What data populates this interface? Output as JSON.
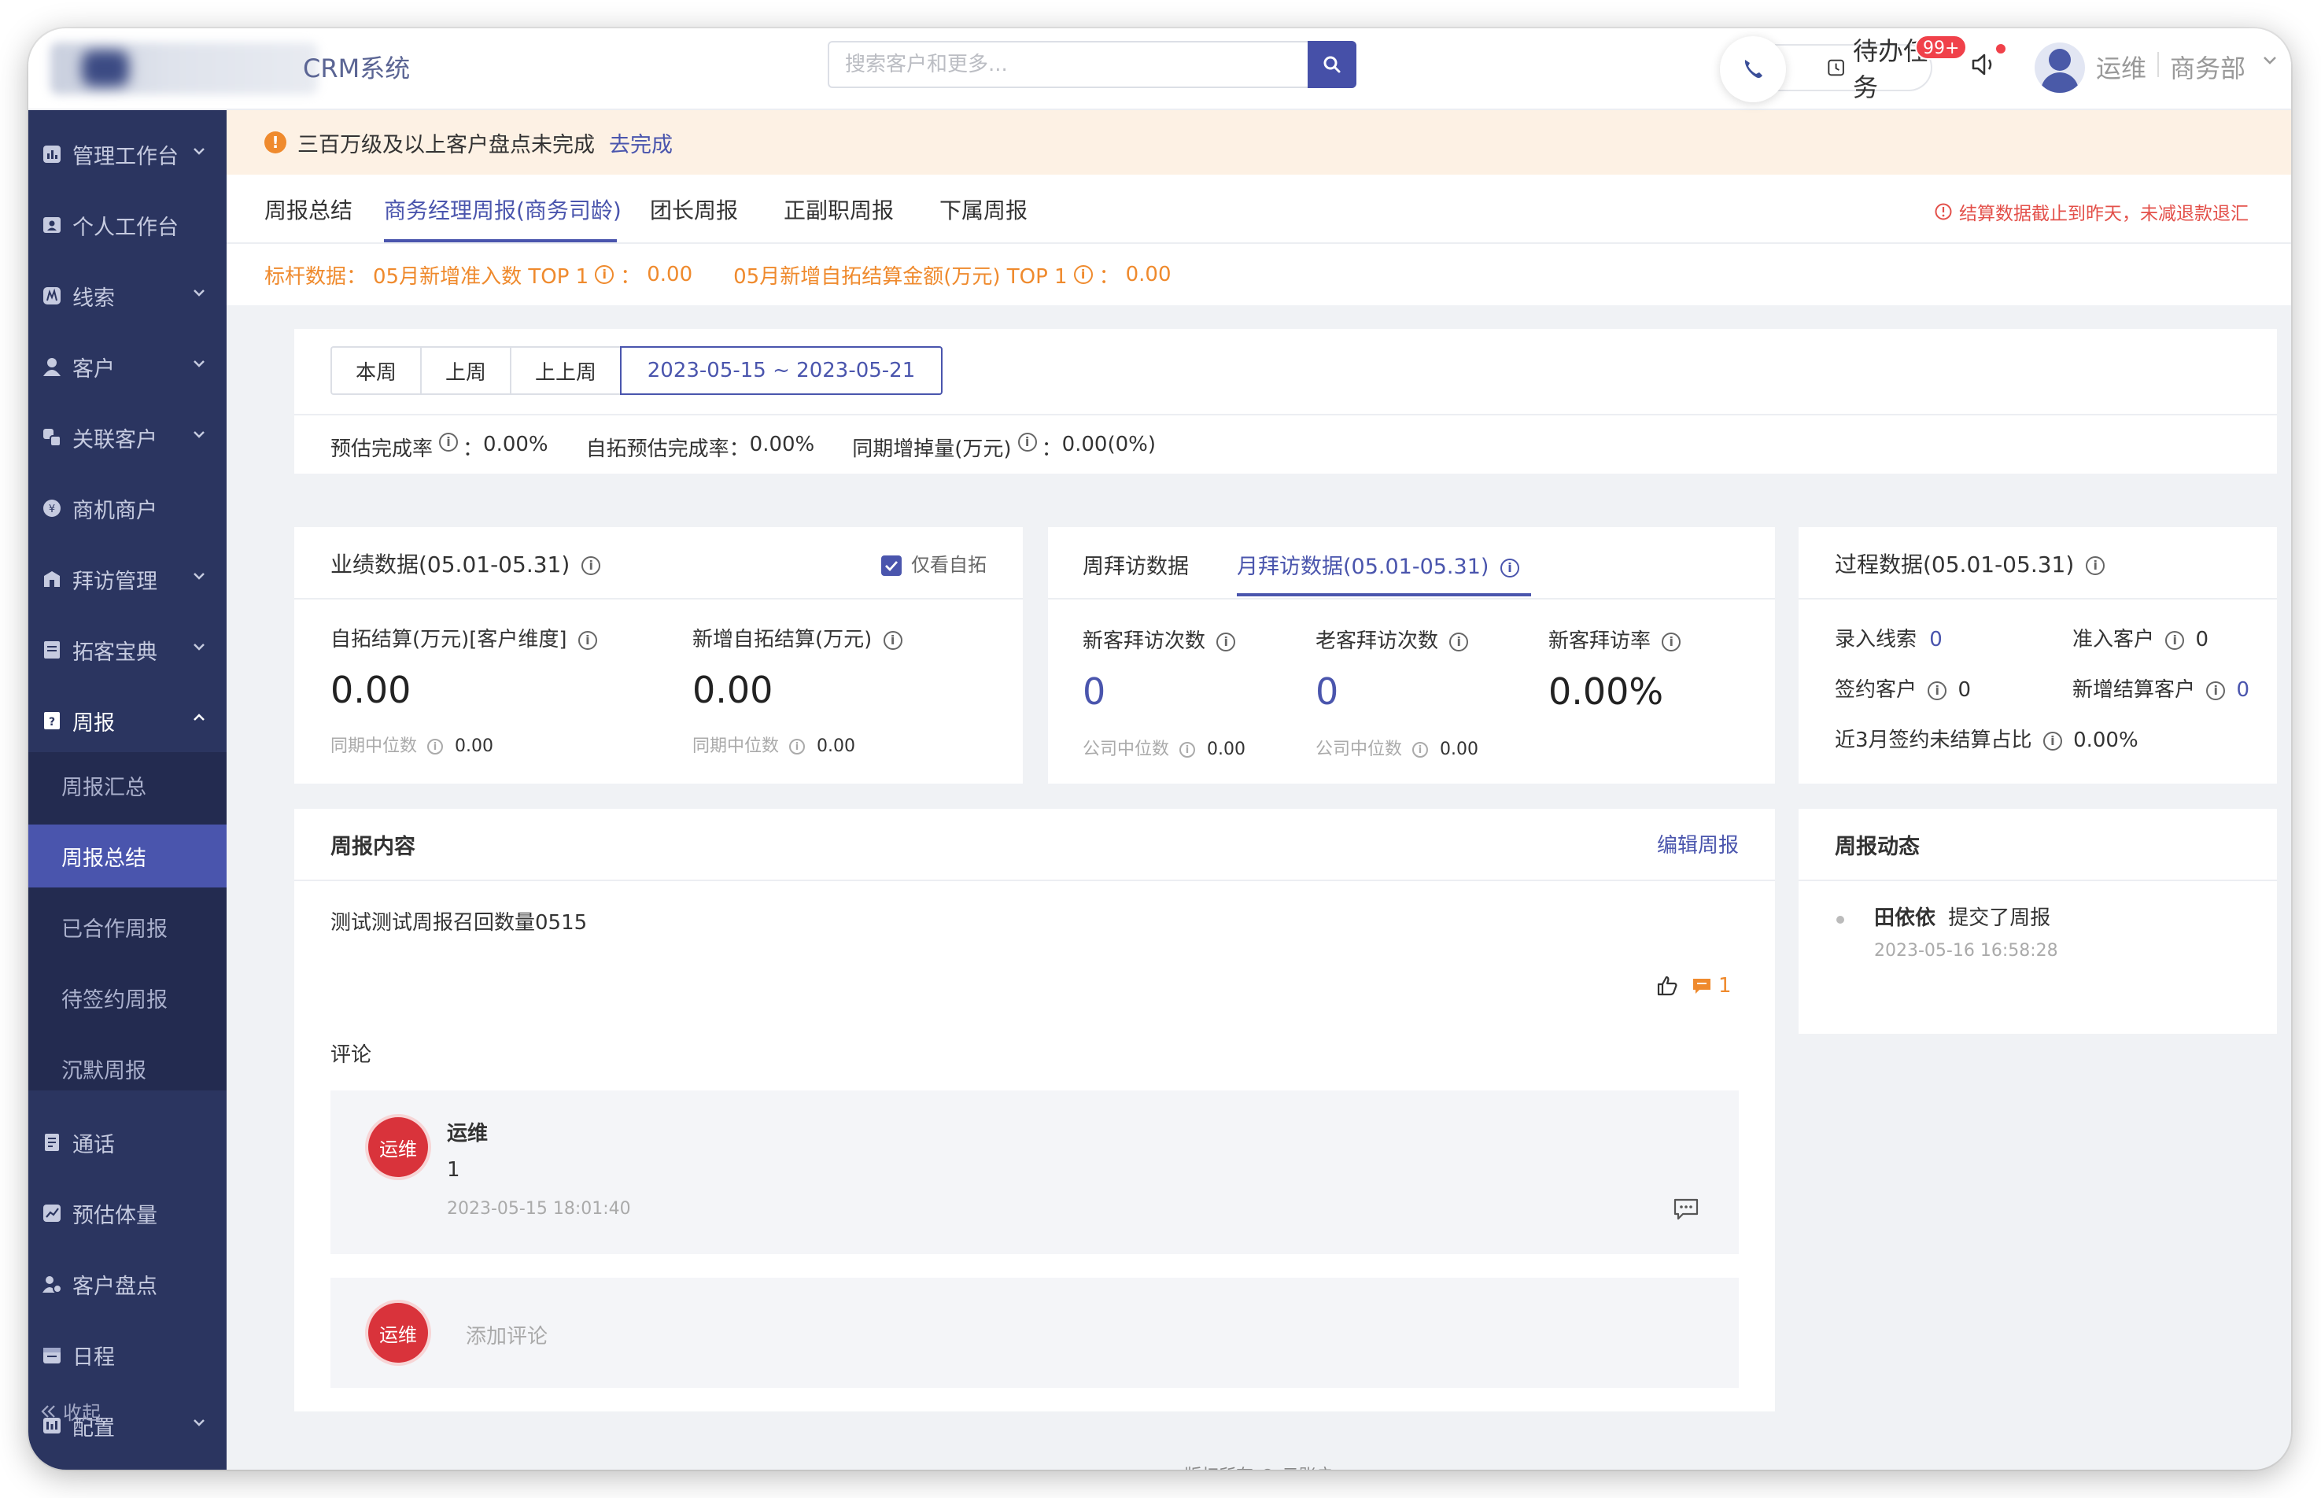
{
  "header": {
    "app_title": "CRM系统",
    "search_placeholder": "搜索客户和更多...",
    "todo_label": "待办任务",
    "todo_badge": "99+",
    "user_name": "运维",
    "user_dept": "商务部"
  },
  "sidebar": {
    "items": [
      {
        "label": "管理工作台",
        "icon": "dashboard-icon",
        "caret": true
      },
      {
        "label": "个人工作台",
        "icon": "user-card-icon",
        "caret": false
      },
      {
        "label": "线索",
        "icon": "clue-icon",
        "caret": true
      },
      {
        "label": "客户",
        "icon": "person-icon",
        "caret": true
      },
      {
        "label": "关联客户",
        "icon": "link-customer-icon",
        "caret": true
      },
      {
        "label": "商机商户",
        "icon": "coin-icon",
        "caret": false
      },
      {
        "label": "拜访管理",
        "icon": "visit-icon",
        "caret": true
      },
      {
        "label": "拓客宝典",
        "icon": "book-icon",
        "caret": true
      },
      {
        "label": "周报",
        "icon": "report-icon",
        "caret": "up"
      }
    ],
    "sub_items": [
      "周报汇总",
      "周报总结",
      "已合作周报",
      "待签约周报",
      "沉默周报"
    ],
    "active_sub": "周报总结",
    "bottom_items": [
      {
        "label": "通话",
        "icon": "call-log-icon",
        "caret": false
      },
      {
        "label": "预估体量",
        "icon": "estimate-icon",
        "caret": false
      },
      {
        "label": "客户盘点",
        "icon": "inventory-icon",
        "caret": false
      },
      {
        "label": "日程",
        "icon": "calendar-icon",
        "caret": false
      },
      {
        "label": "配置",
        "icon": "config-icon",
        "caret": true
      }
    ],
    "collapse_label": "收起"
  },
  "notice": {
    "text": "三百万级及以上客户盘点未完成",
    "link": "去完成"
  },
  "tabs": {
    "items": [
      "周报总结",
      "商务经理周报(商务司龄)",
      "团长周报",
      "正副职周报",
      "下属周报"
    ],
    "active": "商务经理周报(商务司龄)",
    "note": "结算数据截止到昨天，未减退款退汇"
  },
  "benchmark": {
    "label": "标杆数据：",
    "item1_label": "05月新增准入数 TOP 1",
    "item1_value": "0.00",
    "item2_label": "05月新增自拓结算金额(万元) TOP 1",
    "item2_value": "0.00"
  },
  "period": {
    "buttons": [
      "本周",
      "上周",
      "上上周"
    ],
    "range": "2023-05-15 ~ 2023-05-21",
    "stats": [
      {
        "label": "预估完成率",
        "info": true,
        "value": "0.00%"
      },
      {
        "label": "自拓预估完成率：",
        "info": false,
        "value": "0.00%"
      },
      {
        "label": "同期增掉量(万元)",
        "info": true,
        "value": "0.00(0%)"
      }
    ]
  },
  "performance": {
    "title": "业绩数据(05.01-05.31)",
    "checkbox_label": "仅看自拓",
    "metrics": [
      {
        "label": "自拓结算(万元)[客户维度]",
        "value": "0.00",
        "median_label": "同期中位数",
        "median_value": "0.00"
      },
      {
        "label": "新增自拓结算(万元)",
        "value": "0.00",
        "median_label": "同期中位数",
        "median_value": "0.00"
      }
    ]
  },
  "visits": {
    "tabs": [
      "周拜访数据",
      "月拜访数据(05.01-05.31)"
    ],
    "active_tab": "月拜访数据(05.01-05.31)",
    "metrics": [
      {
        "label": "新客拜访次数",
        "value": "0",
        "median_label": "公司中位数",
        "median_value": "0.00"
      },
      {
        "label": "老客拜访次数",
        "value": "0",
        "median_label": "公司中位数",
        "median_value": "0.00"
      },
      {
        "label": "新客拜访率",
        "value": "0.00%"
      }
    ]
  },
  "process": {
    "title": "过程数据(05.01-05.31)",
    "items": [
      {
        "label": "录入线索",
        "value": "0"
      },
      {
        "label": "准入客户",
        "value": "0"
      },
      {
        "label": "签约客户",
        "value": "0"
      },
      {
        "label": "新增结算客户",
        "value": "0"
      },
      {
        "label": "近3月签约未结算占比",
        "value": "0.00%"
      }
    ]
  },
  "report": {
    "title": "周报内容",
    "edit_label": "编辑周报",
    "content": "测试测试周报召回数量0515",
    "comment_count": "1",
    "comments_title": "评论",
    "comment": {
      "avatar": "运维",
      "author": "运维",
      "text": "1",
      "time": "2023-05-15 18:01:40"
    },
    "add_avatar": "运维",
    "add_placeholder": "添加评论"
  },
  "activity": {
    "title": "周报动态",
    "items": [
      {
        "who": "田依依",
        "action": "提交了周报",
        "time": "2023-05-16 16:58:28"
      }
    ]
  },
  "footer": "版权所有 © 云账户",
  "colors": {
    "primary": "#4a55ad",
    "sidebar": "#2b3560",
    "warning": "#ef8a2d",
    "danger": "#e3504a"
  }
}
